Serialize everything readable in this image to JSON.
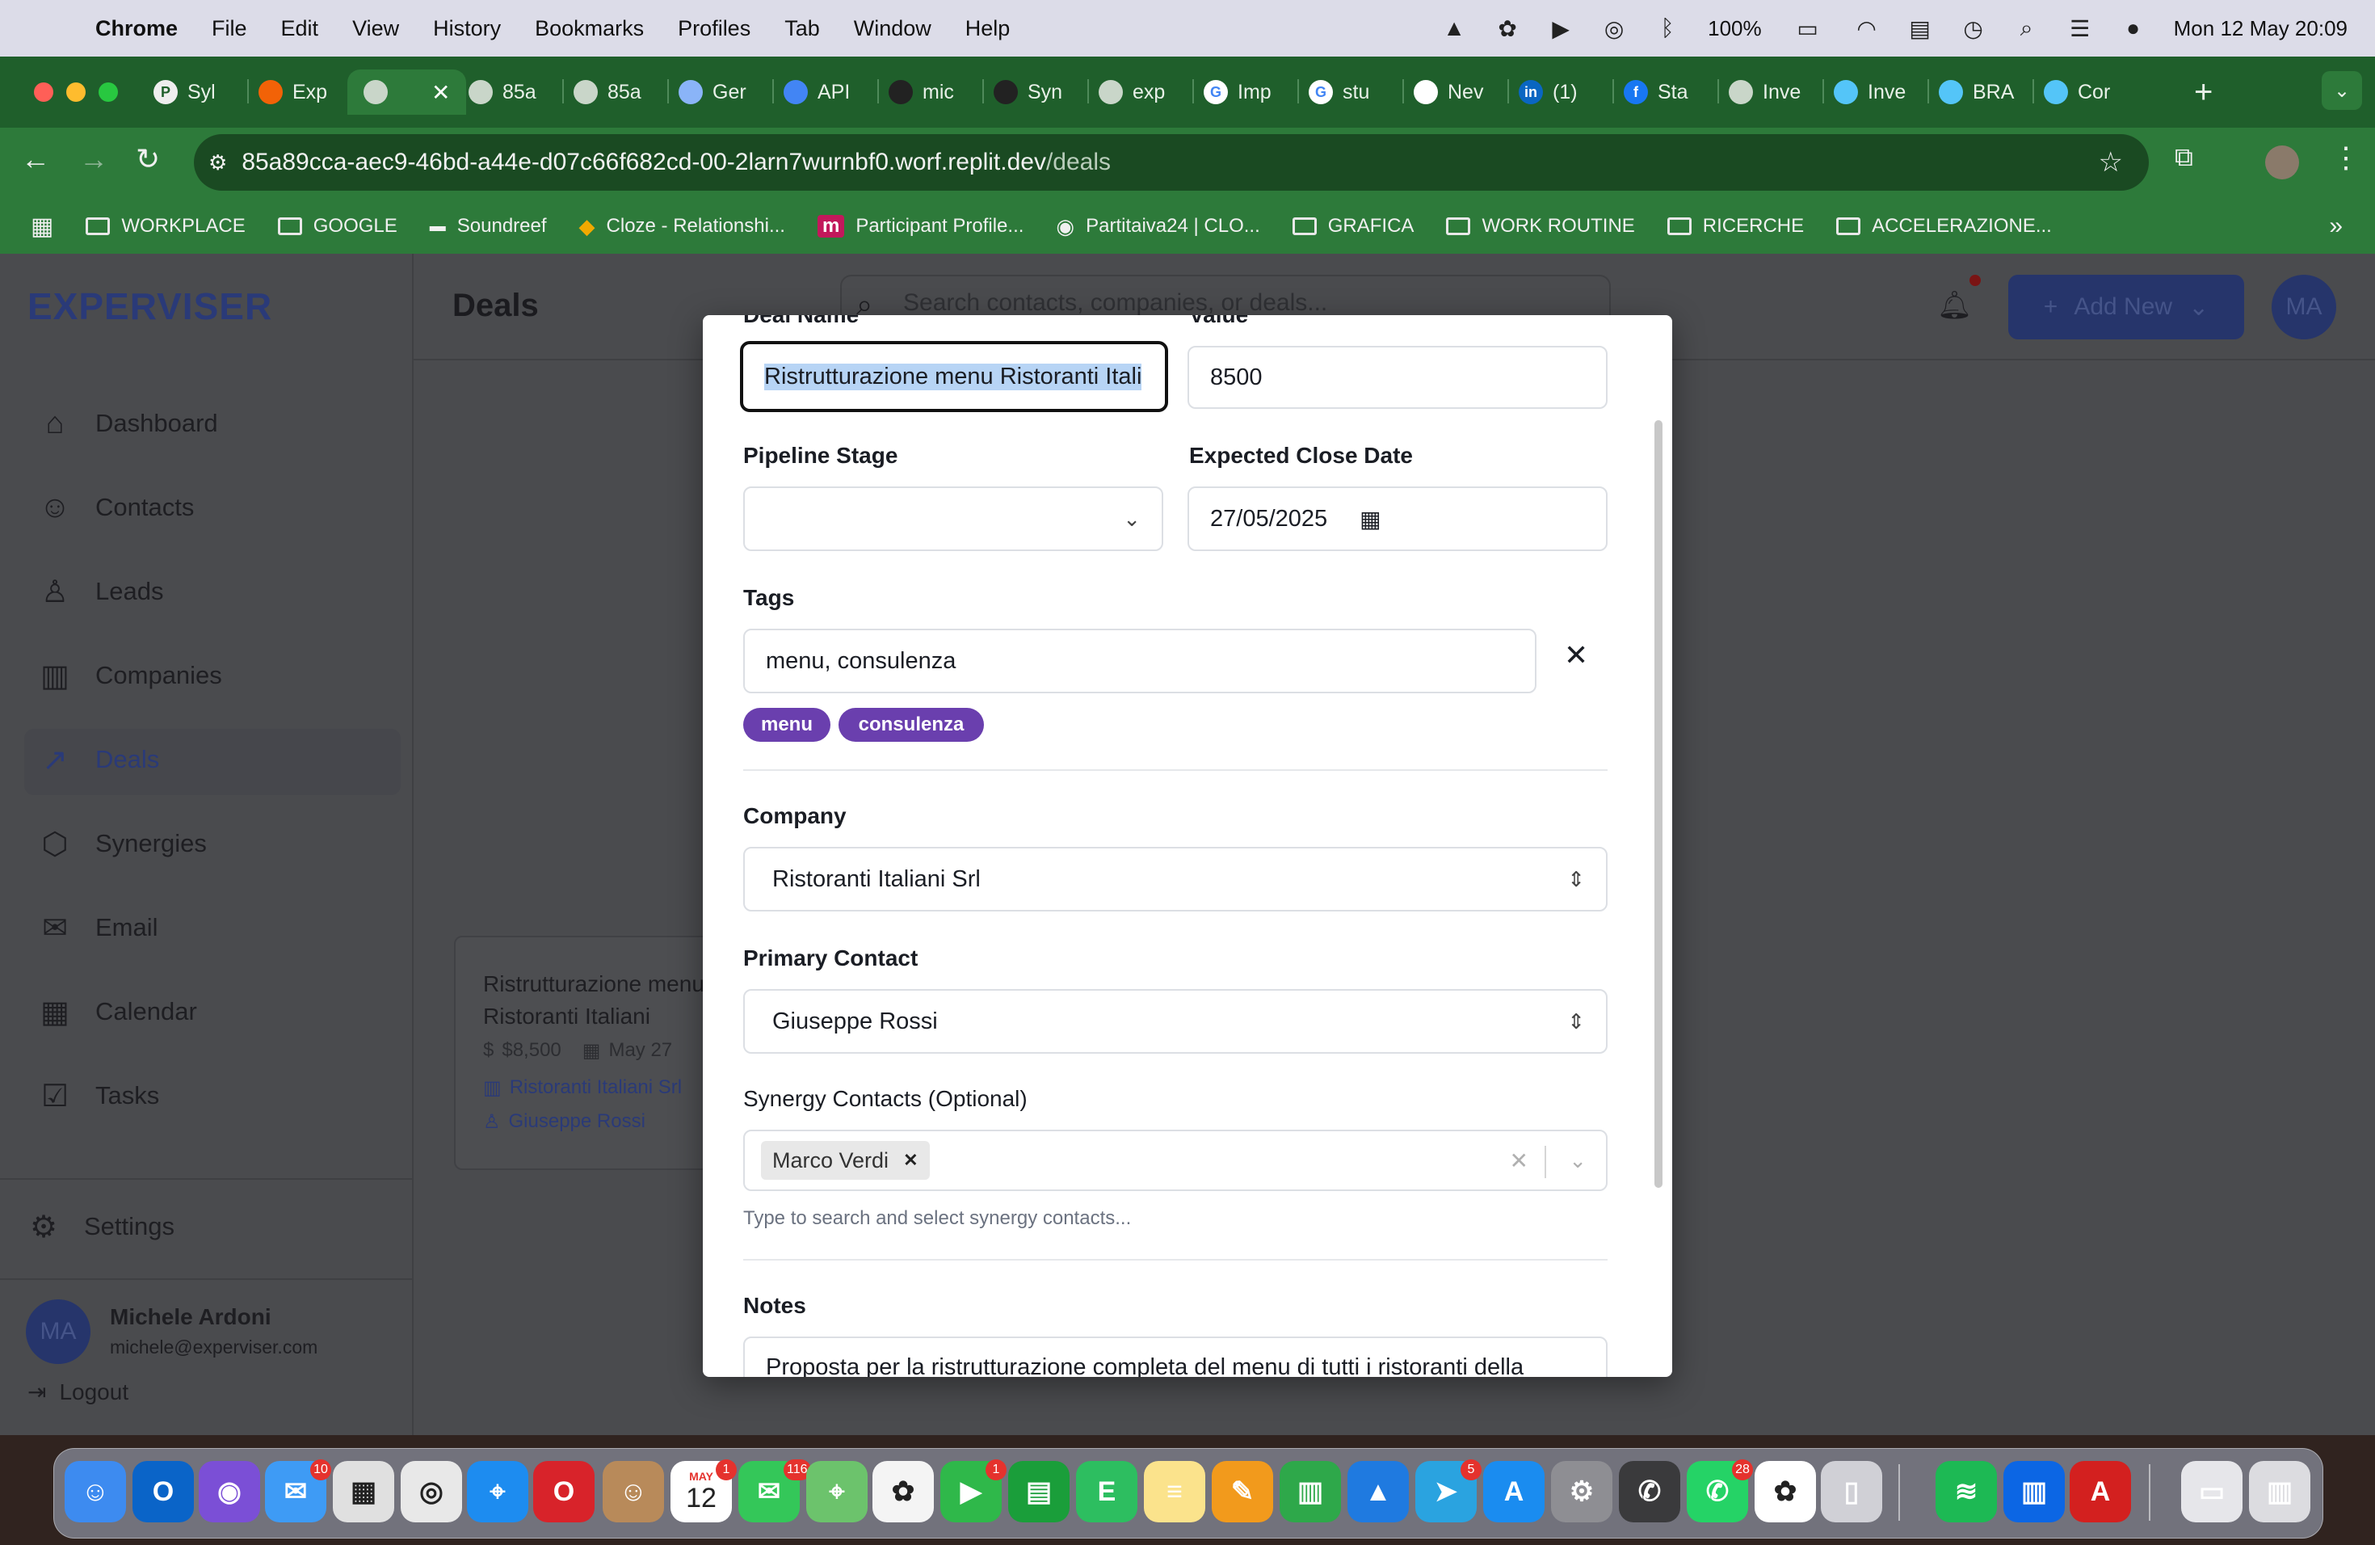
{
  "menubar": {
    "app_name": "Chrome",
    "items": [
      "File",
      "Edit",
      "View",
      "History",
      "Bookmarks",
      "Profiles",
      "Tab",
      "Window",
      "Help"
    ],
    "battery": "100%",
    "datetime": "Mon 12 May  20:09"
  },
  "tabs": [
    {
      "label": "Syl",
      "icon": "P"
    },
    {
      "label": "Exp",
      "icon": "replit"
    },
    {
      "label": "",
      "icon": "globe",
      "active": true
    },
    {
      "label": "85a",
      "icon": "globe"
    },
    {
      "label": "85a",
      "icon": "globe"
    },
    {
      "label": "Ger",
      "icon": "gemini"
    },
    {
      "label": "API",
      "icon": "api"
    },
    {
      "label": "mic",
      "icon": "github"
    },
    {
      "label": "Syn",
      "icon": "github"
    },
    {
      "label": "exp",
      "icon": "globe"
    },
    {
      "label": "Imp",
      "icon": "G"
    },
    {
      "label": "stu",
      "icon": "G"
    },
    {
      "label": "Nev",
      "icon": "chrome"
    },
    {
      "label": "(1)",
      "icon": "in"
    },
    {
      "label": "Sta",
      "icon": "f"
    },
    {
      "label": "Inve",
      "icon": "globe"
    },
    {
      "label": "Inve",
      "icon": "flutter"
    },
    {
      "label": "BRA",
      "icon": "flutter"
    },
    {
      "label": "Cor",
      "icon": "flutter"
    }
  ],
  "address": {
    "domain": "85a89cca-aec9-46bd-a44e-d07c66f682cd-00-2larn7wurnbf0.worf.replit.dev",
    "path": "/deals"
  },
  "bookmarks": [
    {
      "label": "WORKPLACE",
      "type": "folder"
    },
    {
      "label": "GOOGLE",
      "type": "folder"
    },
    {
      "label": "Soundreef",
      "type": "site"
    },
    {
      "label": "Cloze - Relationshi...",
      "type": "site"
    },
    {
      "label": "Participant Profile...",
      "type": "site"
    },
    {
      "label": "Partitaiva24 | CLO...",
      "type": "site"
    },
    {
      "label": "GRAFICA",
      "type": "folder"
    },
    {
      "label": "WORK ROUTINE",
      "type": "folder"
    },
    {
      "label": "RICERCHE",
      "type": "folder"
    },
    {
      "label": "ACCELERAZIONE...",
      "type": "folder"
    }
  ],
  "app": {
    "logo": "EXPERVISER",
    "page_title": "Deals",
    "search_placeholder": "Search contacts, companies, or deals...",
    "add_new": "Add New",
    "avatar_initials": "MA",
    "nav": [
      {
        "label": "Dashboard",
        "icon": "home-icon"
      },
      {
        "label": "Contacts",
        "icon": "users-icon"
      },
      {
        "label": "Leads",
        "icon": "user-plus-icon"
      },
      {
        "label": "Companies",
        "icon": "building-icon"
      },
      {
        "label": "Deals",
        "icon": "trending-up-icon",
        "active": true
      },
      {
        "label": "Synergies",
        "icon": "handshake-icon"
      },
      {
        "label": "Email",
        "icon": "mail-icon"
      },
      {
        "label": "Calendar",
        "icon": "calendar-icon"
      },
      {
        "label": "Tasks",
        "icon": "check-square-icon"
      }
    ],
    "settings": "Settings",
    "user": {
      "name": "Michele Ardoni",
      "email": "michele@experviser.com",
      "initials": "MA"
    },
    "logout": "Logout",
    "deal_card": {
      "title_line1": "Ristrutturazione menu",
      "title_line2": "Ristoranti Italiani",
      "value": "$8,500",
      "date": "May 27",
      "company": "Ristoranti Italiani Srl",
      "contact": "Giuseppe Rossi"
    }
  },
  "modal": {
    "deal_name_label": "Deal Name",
    "deal_name_value": "Ristrutturazione menu Ristoranti Itali",
    "value_label": "Value",
    "value_value": "8500",
    "pipeline_label": "Pipeline Stage",
    "pipeline_value": "",
    "close_date_label": "Expected Close Date",
    "close_date_value": "27/05/2025",
    "tags_label": "Tags",
    "tags_value": "menu, consulenza",
    "tag_chips": [
      "menu",
      "consulenza"
    ],
    "company_label": "Company",
    "company_value": "Ristoranti Italiani Srl",
    "contact_label": "Primary Contact",
    "contact_value": "Giuseppe Rossi",
    "synergy_label": "Synergy Contacts (Optional)",
    "synergy_selected": [
      "Marco Verdi"
    ],
    "synergy_help": "Type to search and select synergy contacts...",
    "notes_label": "Notes",
    "notes_value": "Proposta per la ristrutturazione completa del menu di tutti i ristoranti della"
  },
  "dock": {
    "badges": {
      "mail": "10",
      "calendar": "1",
      "messages": "116",
      "facetime": "1",
      "telegram": "5",
      "whatsapp": "28"
    },
    "calendar_month": "MAY",
    "calendar_day": "12"
  }
}
